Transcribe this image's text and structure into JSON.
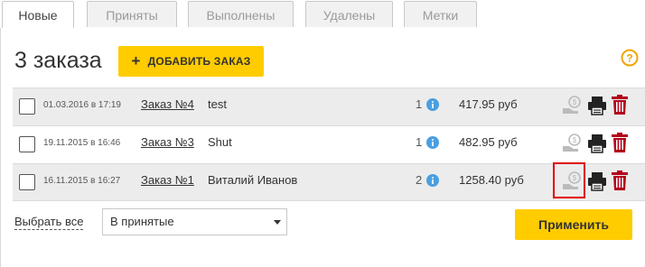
{
  "tabs": [
    {
      "label": "Новые",
      "active": true
    },
    {
      "label": "Приняты",
      "active": false
    },
    {
      "label": "Выполнены",
      "active": false
    },
    {
      "label": "Удалены",
      "active": false
    },
    {
      "label": "Метки",
      "active": false
    }
  ],
  "header": {
    "title": "3 заказа",
    "add_button_plus": "+",
    "add_button_label": "ДОБАВИТЬ ЗАКАЗ",
    "help_icon": "question-circle-icon"
  },
  "orders": [
    {
      "date": "01.03.2016 в 17:19",
      "order": "Заказ №4",
      "name": "test",
      "count": "1",
      "price": "417.95 руб"
    },
    {
      "date": "19.11.2015 в 16:46",
      "order": "Заказ №3",
      "name": "Shut",
      "count": "1",
      "price": "482.95 руб"
    },
    {
      "date": "16.11.2015 в 16:27",
      "order": "Заказ №1",
      "name": "Виталий Иванов",
      "count": "2",
      "price": "1258.40 руб"
    }
  ],
  "footer": {
    "select_all": "Выбрать все",
    "action_select_value": "В принятые",
    "apply_button": "Применить"
  },
  "colors": {
    "accent": "#ffcc00",
    "info_blue": "#4a9fe0",
    "trash_red": "#b3001b",
    "highlight_red": "#e00000"
  }
}
